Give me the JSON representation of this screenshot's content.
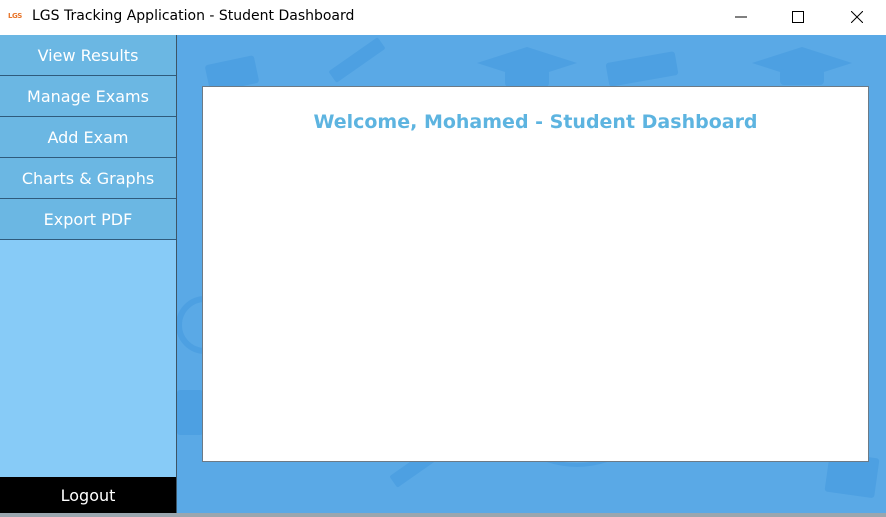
{
  "window": {
    "logo_text": "LGS",
    "title": "LGS Tracking Application - Student Dashboard",
    "controls": [
      "minimize",
      "maximize",
      "close"
    ]
  },
  "sidebar": {
    "items": [
      {
        "label": "View Results"
      },
      {
        "label": "Manage Exams"
      },
      {
        "label": "Add Exam"
      },
      {
        "label": "Charts & Graphs"
      },
      {
        "label": "Export PDF"
      }
    ],
    "logout_label": "Logout"
  },
  "main": {
    "welcome_text": "Welcome, Mohamed - Student Dashboard"
  },
  "colors": {
    "sidebar_bg": "#87cbf7",
    "nav_button": "#6bb7e3",
    "background_pattern": "#5aa9e6",
    "welcome_text": "#5db4e0",
    "logout_bg": "#000000"
  },
  "icons": [
    "app-logo",
    "minimize-icon",
    "maximize-icon",
    "close-icon",
    "graduation-cap-icon",
    "pencil-icon",
    "book-icon"
  ]
}
